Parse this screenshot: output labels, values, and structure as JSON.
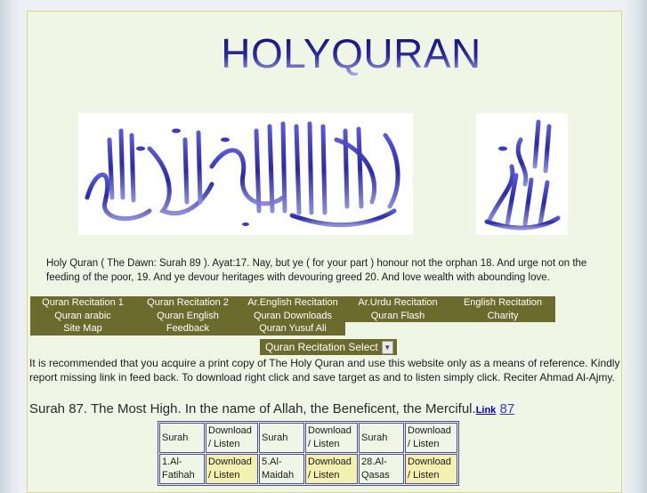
{
  "site": {
    "banner_title": "HOLYQURAN"
  },
  "calligraphy": {
    "left_name": "shahada-calligraphy",
    "right_name": "allahu-akbar-calligraphy",
    "color": "#3b3bbf"
  },
  "intro_text": "Holy Quran ( The Dawn: Surah 89 ). Ayat:17. Nay, but ye ( for your part ) honour not the orphan 18. And urge not on the feeding of the poor, 19. And ye devour heritages with devouring greed 20. And love wealth with abounding love.",
  "menu": {
    "items": [
      "Quran Recitation 1",
      "Quran Recitation 2",
      "Ar.English Recitation",
      "Ar.Urdu Recitation",
      "English Recitation",
      "Quran arabic",
      "Quran English",
      "Quran Downloads",
      "Quran Flash",
      "Charity",
      "Site Map",
      "Feedback",
      "Quran Yusuf Ali"
    ]
  },
  "recitation_select": {
    "label": "Quran Recitation Select"
  },
  "notice": "It is recommended that you acquire a print copy of The Holy Quran and use this website only as a means of reference. Kindly report missing link in feed back. To download right click and save target as and to listen simply click. Reciter Ahmad Al-Ajmy.",
  "surah_heading": {
    "text": "Surah 87. The Most High. In the name of Allah, the Beneficent, the Merciful.",
    "link_label": "Link",
    "link_number": "87"
  },
  "index_table": {
    "headers": [
      "Surah",
      "Download / Listen",
      "Surah",
      "Download / Listen",
      "Surah",
      "Download / Listen"
    ],
    "rows": [
      [
        "1.Al-Fatihah",
        "Download / Listen",
        "5.Al-Maidah",
        "Download / Listen",
        "28.Al-Qasas",
        "Download / Listen"
      ]
    ]
  },
  "colors": {
    "page_bg": "#f0f6e6",
    "menu_bg": "#6b6b2e",
    "download_cell_bg": "#f4f0b0",
    "table_border": "#4a4aa0",
    "link": "#0000cc"
  }
}
